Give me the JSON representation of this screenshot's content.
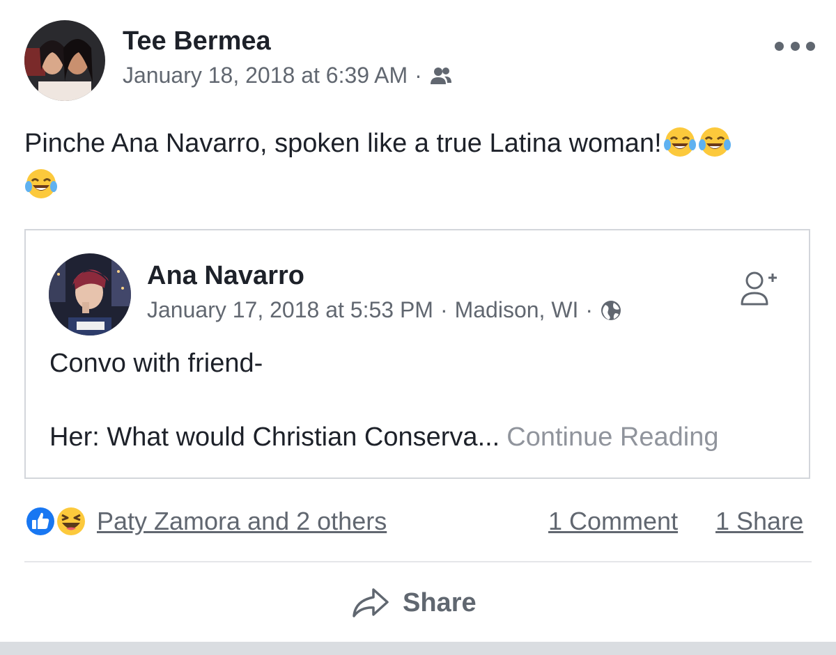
{
  "post": {
    "author_name": "Tee Bermea",
    "timestamp": "January 18, 2018 at 6:39 AM",
    "separator": "·",
    "audience_icon": "friends-icon",
    "more_icon": "more-options-icon",
    "text": "Pinche Ana Navarro, spoken like a true Latina woman!",
    "emojis": [
      "face-with-tears-of-joy",
      "face-with-tears-of-joy",
      "face-with-tears-of-joy"
    ]
  },
  "shared_post": {
    "author_name": "Ana Navarro",
    "timestamp": "January 17, 2018 at 5:53 PM",
    "separator": "·",
    "location": "Madison, WI",
    "audience_icon": "globe-icon",
    "add_friend_icon": "add-friend-icon",
    "line1": "Convo with friend-",
    "line2": "Her: What would Christian Conserva...",
    "continue_label": "Continue Reading"
  },
  "engagement": {
    "reaction_icons": [
      "like-reaction-icon",
      "haha-reaction-icon"
    ],
    "reactors": "Paty Zamora and 2 others",
    "comments": "1 Comment",
    "shares": "1 Share"
  },
  "actions": {
    "share_label": "Share",
    "share_icon": "share-arrow-icon"
  },
  "colors": {
    "text_primary": "#1d2129",
    "text_secondary": "#616770",
    "link_muted": "#90949c",
    "like_blue": "#1877f2",
    "emoji_yellow": "#fcc93c",
    "border": "#d3d6db"
  }
}
